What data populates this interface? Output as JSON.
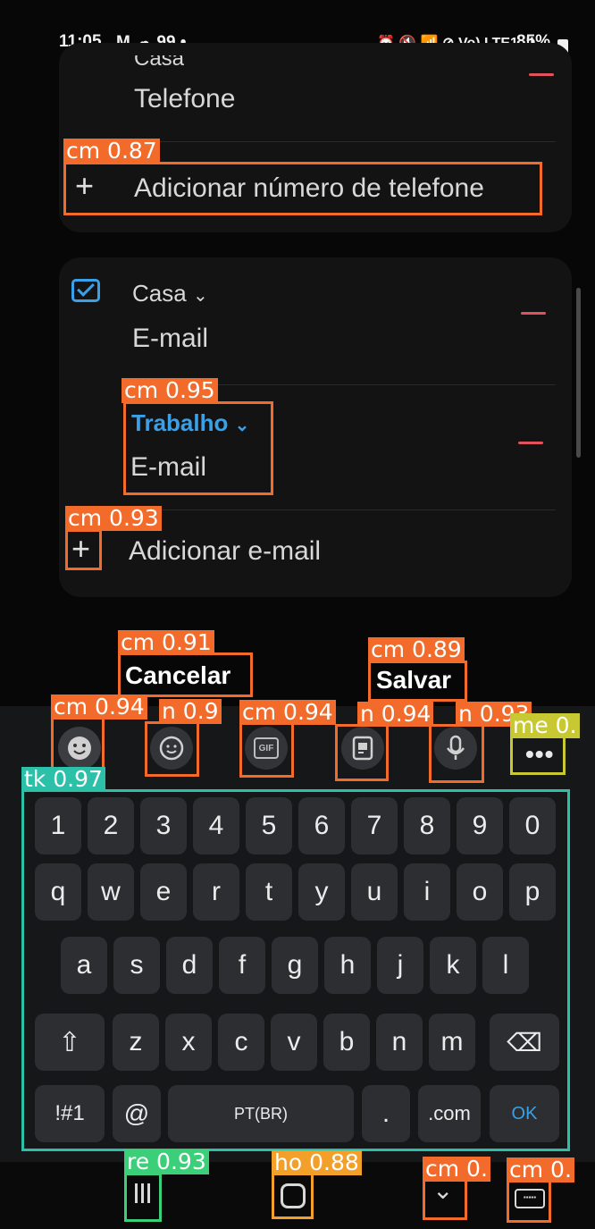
{
  "status_bar": {
    "time": "11:05",
    "left_icons": "M ☁ 99 •",
    "right_icons": "⏰ 🔇 📶 ⊘ Vo) LTE1 .ıl",
    "battery": "85%"
  },
  "phone_section": {
    "partial_type": "Casa",
    "field_label": "Telefone",
    "add_label": "Adicionar número de telefone"
  },
  "email_section": {
    "entries": [
      {
        "type": "Casa",
        "placeholder": "E-mail"
      },
      {
        "type": "Trabalho",
        "placeholder": "E-mail"
      }
    ],
    "add_label": "Adicionar e-mail"
  },
  "actions": {
    "cancel_label": "Cancelar",
    "save_label": "Salvar"
  },
  "toolbar": {
    "gif_label": "GIF"
  },
  "keyboard": {
    "number_row": [
      "1",
      "2",
      "3",
      "4",
      "5",
      "6",
      "7",
      "8",
      "9",
      "0"
    ],
    "row1": [
      "q",
      "w",
      "e",
      "r",
      "t",
      "y",
      "u",
      "i",
      "o",
      "p"
    ],
    "row2": [
      "a",
      "s",
      "d",
      "f",
      "g",
      "h",
      "j",
      "k",
      "l"
    ],
    "row3": [
      "z",
      "x",
      "c",
      "v",
      "b",
      "n",
      "m"
    ],
    "symbols_label": "!#1",
    "at_label": "@",
    "space_label": "PT(BR)",
    "dot_label": ".",
    "dotcom_label": ".com",
    "ok_label": "OK"
  },
  "detections": {
    "cm_phone_add": "cm 0.87",
    "cm_trabalho": "cm 0.95",
    "cm_add_email": "cm 0.93",
    "cm_cancel": "cm 0.91",
    "cm_save": "cm 0.89",
    "cm_emoji": "cm 0.94",
    "n_sticker": "n 0.9",
    "cm_gif": "cm 0.94",
    "n_clipboard": "n 0.94",
    "n_mic": "n 0.93",
    "me_more": "me 0.",
    "tk_keyboard": "tk 0.97",
    "re_recents": "re 0.93",
    "ho_home": "ho 0.88",
    "cm_back": "cm 0.",
    "cm_kbd": "cm 0."
  },
  "colors": {
    "background": "#070707",
    "card": "#131314",
    "accent_blue": "#3aa0e8",
    "remove_red": "#e2525e",
    "box_orange": "#f26b2a",
    "box_teal": "#2cc0a8",
    "box_yellow": "#c8c832",
    "box_green": "#3ccf7a",
    "box_amber": "#f2a02a"
  }
}
